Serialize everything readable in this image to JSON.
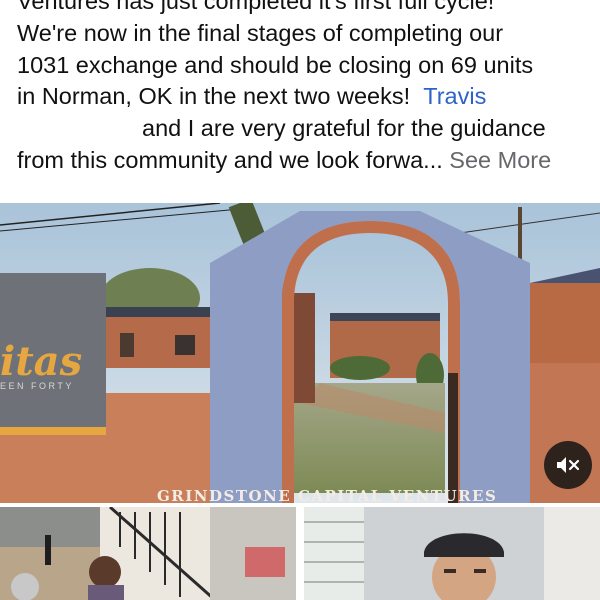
{
  "post": {
    "line1": "Ventures has just completed it's first full cycle!",
    "line2": "We're now in the final stages of completing our",
    "line3": "1031 exchange and should be closing on 69 units",
    "line4_text": "in Norman, OK in the next two weeks!",
    "mention": "Travis",
    "line5": "and I are very grateful for the guidance",
    "line6": "from this community and we look forwa...",
    "see_more": "See More"
  },
  "video": {
    "watermark": "GRINDSTONE CAPITAL VENTURES",
    "sign_text": "itas",
    "sign_subtext": "EEN FORTY",
    "mute_icon": "speaker-muted-icon"
  },
  "colors": {
    "mention": "#2d63c8",
    "see_more": "#65676b",
    "sign_gold": "#e6a740"
  }
}
